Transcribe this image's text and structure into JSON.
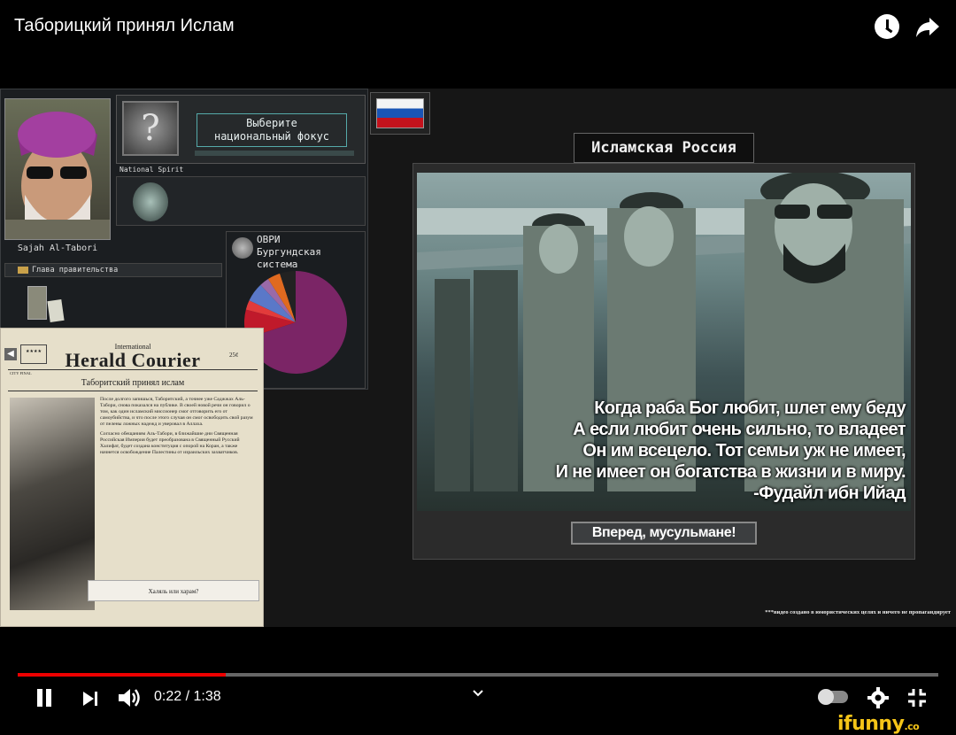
{
  "video": {
    "title": "Таборицкий принял Ислам",
    "time_current": "0:22",
    "time_total": "1:38",
    "time_display": "0:22 / 1:38",
    "progress": 0.226
  },
  "header_icons": [
    "clock-icon",
    "share-icon"
  ],
  "game": {
    "leader_name": "Sajah Al-Tabori",
    "gov_label": "Глава правительства",
    "focus_prompt_line1": "Выберите",
    "focus_prompt_line2": "национальный фокус",
    "national_spirit_label": "National Spirit",
    "ideology_line1": "ОВРИ",
    "ideology_line2": "Бургундская",
    "ideology_line3": "система",
    "ideology_slices": [
      {
        "color": "#7b2566",
        "value": 0.7
      },
      {
        "color": "#c01a2b",
        "value": 0.09
      },
      {
        "color": "#e23b3b",
        "value": 0.03
      },
      {
        "color": "#5a78c8",
        "value": 0.06
      },
      {
        "color": "#9a6aa8",
        "value": 0.03
      },
      {
        "color": "#e06a20",
        "value": 0.04
      },
      {
        "color": "#222222",
        "value": 0.05
      }
    ]
  },
  "newspaper": {
    "intl": "International",
    "masthead": "Herald Courier",
    "price": "25¢",
    "city": "CITY FINAL",
    "headline": "Таборитский принял ислам",
    "para1": "После долгого запишься, Таборитский, а точнее уже Саджжах Аль-Табори, снова показался на публике. В своей новой речи он говорил о том, как один исламский миссионер смог отговорить его от самоубийства, и что после этого случая он смог освободить свой разум от пелены ложных надежд и уверовал в Аллаха.",
    "para2": "Согласно обещаниям Аль-Табори, в ближайшие дни Священная Российская Империя будет преобразована в Священный Русский Халифат, будет создана конституция с опорой на Коран, а также начнется освобождение Палестины от израильских захватчиков.",
    "button": "Халяль или харам?"
  },
  "event": {
    "title": "Исламская Россия",
    "quote_line1": "Когда раба Бог любит, шлет ему беду",
    "quote_line2": "А если любит очень сильно, то владеет",
    "quote_line3": "Он им всецело. Тот семьи уж не имеет,",
    "quote_line4": "И не имеет он богатства в жизни и в миру.",
    "quote_line5": "-Фудайл ибн Ийад",
    "button": "Вперед, мусульмане!"
  },
  "disclaimer": "***видео создано в юмористических целях и ничего не пропагандирует",
  "watermark": "ifunny",
  "watermark_tld": ".co"
}
